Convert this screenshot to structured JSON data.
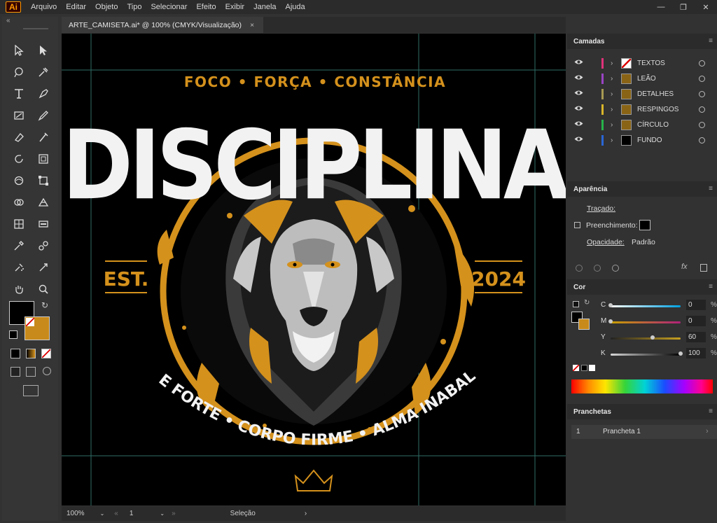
{
  "app": {
    "logo": "Ai"
  },
  "menu": [
    "Arquivo",
    "Editar",
    "Objeto",
    "Tipo",
    "Selecionar",
    "Efeito",
    "Exibir",
    "Janela",
    "Ajuda"
  ],
  "window_controls": [
    "—",
    "❐",
    "✕"
  ],
  "document_tab": {
    "title": "ARTE_CAMISETA.ai* @ 100% (CMYK/Visualização)",
    "close": "×"
  },
  "toolbar": {
    "collapse": "«"
  },
  "artwork": {
    "top_tagline": "FOCO • FORÇA • CONSTÂNCIA",
    "headline": "DISCIPLINA",
    "left_label": "EST.",
    "right_label": "2024",
    "bottom_arc": "MENTE FORTE • CORPO FIRME • ALMA INABALÁVEL",
    "accent_color": "#d4911c"
  },
  "status": {
    "zoom": "100%",
    "artboard": "1",
    "tool": "Seleção"
  },
  "layers_panel": {
    "title": "Camadas",
    "layers": [
      {
        "name": "TEXTOS",
        "color": "#e0327a"
      },
      {
        "name": "LEÃO",
        "color": "#9a44c4"
      },
      {
        "name": "DETALHES",
        "color": "#a89a52"
      },
      {
        "name": "RESPINGOS",
        "color": "#d8b62a"
      },
      {
        "name": "CÍRCULO",
        "color": "#26b34a"
      },
      {
        "name": "FUNDO",
        "color": "#2a66d6"
      }
    ]
  },
  "appearance_panel": {
    "title": "Aparência",
    "stroke": "Traçado:",
    "fill": "Preenchimento:",
    "opacity": "Opacidade:",
    "opacity_value": "Padrão"
  },
  "color_panel": {
    "title": "Cor",
    "channels": [
      {
        "label": "C",
        "value": "0",
        "fraction": 0.0
      },
      {
        "label": "M",
        "value": "0",
        "fraction": 0.0
      },
      {
        "label": "Y",
        "value": "60",
        "fraction": 0.6
      },
      {
        "label": "K",
        "value": "100",
        "fraction": 1.0
      }
    ],
    "percent": "%"
  },
  "artboards_panel": {
    "title": "Pranchetas",
    "items": [
      {
        "index": "1",
        "name": "Prancheta 1"
      }
    ]
  }
}
